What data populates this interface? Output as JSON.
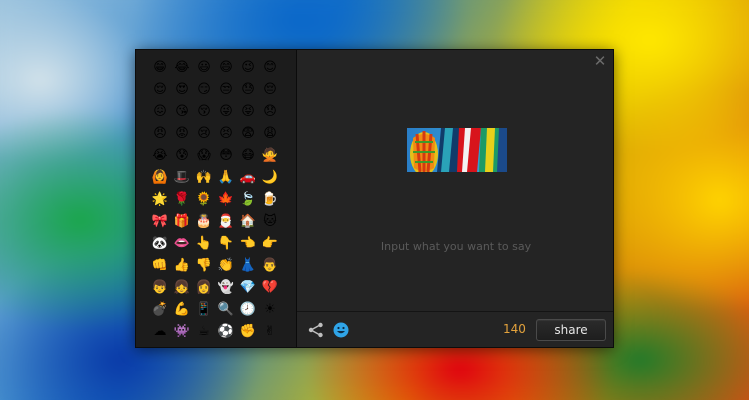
{
  "dialog": {
    "close_label": "✕",
    "placeholder": "Input what you want to say",
    "char_count": "140",
    "share_label": "share",
    "icons": {
      "share": "share-nodes-icon",
      "emoji": "smiley-face-icon"
    },
    "colors": {
      "count": "#e3a23c",
      "panel": "#1c1c1c",
      "dialog": "#242424"
    }
  },
  "emojis": [
    "😁",
    "😂",
    "😃",
    "😄",
    "😉",
    "😊",
    "😌",
    "😍",
    "😏",
    "😒",
    "😓",
    "😔",
    "😖",
    "😘",
    "😚",
    "😜",
    "😝",
    "😞",
    "😠",
    "😡",
    "😢",
    "😣",
    "😨",
    "😩",
    "😭",
    "😰",
    "😱",
    "😳",
    "😷",
    "🙅",
    "🙆",
    "🎩",
    "🙌",
    "🙏",
    "🚗",
    "🌙",
    "🌟",
    "🌹",
    "🌻",
    "🍁",
    "🍃",
    "🍺",
    "🎀",
    "🎁",
    "🎂",
    "🎅",
    "🏠",
    "🐱",
    "🐼",
    "👄",
    "👆",
    "👇",
    "👈",
    "👉",
    "👊",
    "👍",
    "👎",
    "👏",
    "👗",
    "👨",
    "👦",
    "👧",
    "👩",
    "👻",
    "💎",
    "💔",
    "💣",
    "💪",
    "📱",
    "🔍",
    "🕗",
    "☀",
    "☁",
    "👾",
    "☕",
    "⚽",
    "✊",
    "✌"
  ]
}
